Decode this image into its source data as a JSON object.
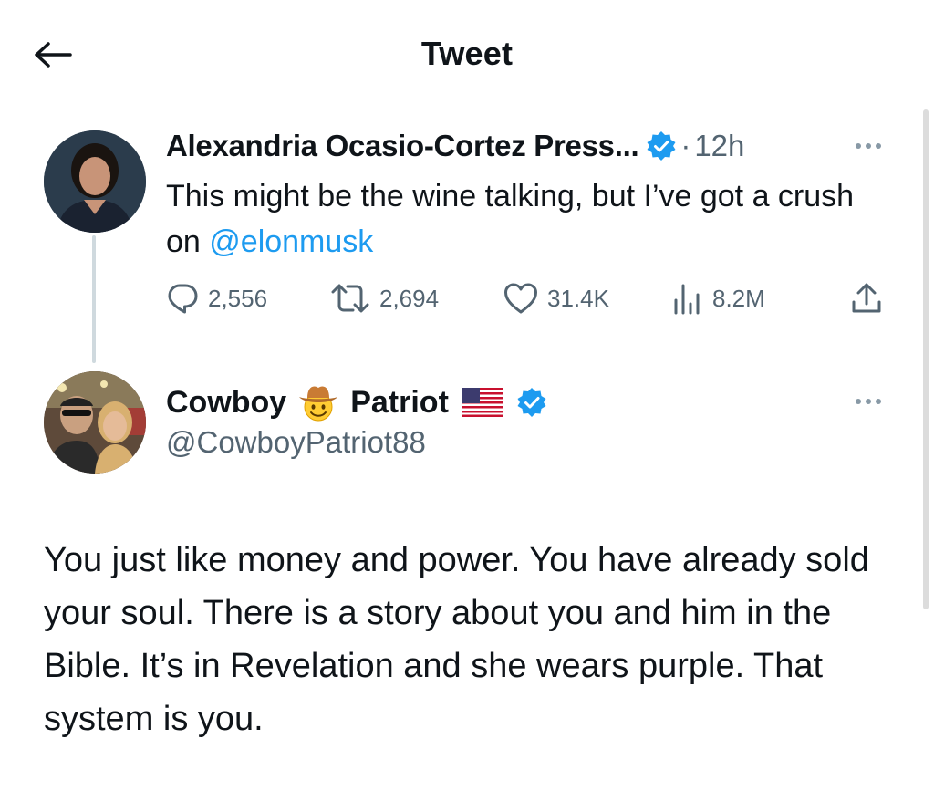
{
  "header": {
    "title": "Tweet",
    "back_icon": "arrow-left-icon"
  },
  "tweet1": {
    "name": "Alexandria Ocasio-Cortez Press...",
    "separator": "·",
    "time": "12h",
    "body_text": "This might be the wine talking, but I’ve got a crush on ",
    "mention": "@elonmusk",
    "stats": {
      "replies": "2,556",
      "retweets": "2,694",
      "likes": "31.4K",
      "views": "8.2M"
    }
  },
  "tweet2": {
    "name_first": "Cowboy",
    "name_emoji": "cowboy-hat-face",
    "name_second": "Patriot",
    "flag": "us-flag",
    "handle": "@CowboyPatriot88",
    "body": "You just like money and power. You have already sold your soul. There is a story about you and him in the Bible. It’s in Revelation and she wears purple. That system is you."
  },
  "colors": {
    "accent": "#1d9bf0",
    "secondary_text": "#536471",
    "thread_line": "#cfd9de"
  }
}
